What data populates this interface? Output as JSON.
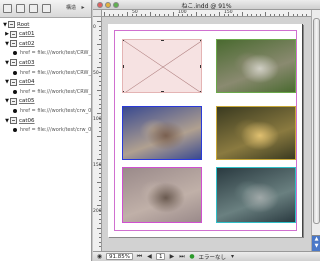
{
  "structure_panel": {
    "toolbar": {
      "icons": [
        "tag-icon",
        "attribute-icon",
        "code-icon",
        "trash-icon"
      ],
      "label": "構造",
      "menu_icon": "panel-menu-icon"
    },
    "tree": [
      {
        "type": "element",
        "depth": 0,
        "label": "Root",
        "expanded": true
      },
      {
        "type": "element",
        "depth": 1,
        "label": "cat01",
        "expanded": false
      },
      {
        "type": "element",
        "depth": 1,
        "label": "cat02",
        "expanded": true
      },
      {
        "type": "attribute",
        "depth": 2,
        "label": "href = file:///work/test/CRW_"
      },
      {
        "type": "element",
        "depth": 1,
        "label": "cat03",
        "expanded": true
      },
      {
        "type": "attribute",
        "depth": 2,
        "label": "href = file:///work/test/CRW_"
      },
      {
        "type": "element",
        "depth": 1,
        "label": "cat04",
        "expanded": true
      },
      {
        "type": "attribute",
        "depth": 2,
        "label": "href = file:///work/test/CRW_"
      },
      {
        "type": "element",
        "depth": 1,
        "label": "cat05",
        "expanded": true
      },
      {
        "type": "attribute",
        "depth": 2,
        "label": "href = file:///work/test/crw_0"
      },
      {
        "type": "element",
        "depth": 1,
        "label": "cat06",
        "expanded": true
      },
      {
        "type": "attribute",
        "depth": 2,
        "label": "href = file:///work/test/crw_0"
      }
    ]
  },
  "document": {
    "title": "ねこ.indd @ 91%",
    "hruler_labels": [
      "50",
      "100",
      "150"
    ],
    "vruler_labels": [
      "0",
      "50",
      "100",
      "150",
      "200"
    ],
    "frames": [
      {
        "name": "empty-graphic-frame",
        "kind": "empty",
        "color": "#e4b4b4"
      },
      {
        "name": "cat-photo-1",
        "kind": "photo",
        "color": "#6aa84a",
        "tones": [
          "#4a6a30",
          "#8a8a70",
          "#d0cfc4"
        ]
      },
      {
        "name": "cat-photo-2",
        "kind": "photo",
        "color": "#2a3ad8",
        "tones": [
          "#3a4a90",
          "#b0a090",
          "#7a6050"
        ]
      },
      {
        "name": "cat-photo-3",
        "kind": "photo",
        "color": "#c8a838",
        "tones": [
          "#3a3a20",
          "#8a7a40",
          "#e0c070"
        ]
      },
      {
        "name": "cat-photo-4",
        "kind": "photo",
        "color": "#d050d0",
        "tones": [
          "#9a8a8a",
          "#c0b0a8",
          "#6a5a50"
        ]
      },
      {
        "name": "cat-photo-5",
        "kind": "photo",
        "color": "#30c0c8",
        "tones": [
          "#2a3a40",
          "#6a8080",
          "#a0a8a8"
        ]
      }
    ]
  },
  "statusbar": {
    "zoom": "91.85%",
    "page_label": "1",
    "status_text": "エラーなし"
  }
}
